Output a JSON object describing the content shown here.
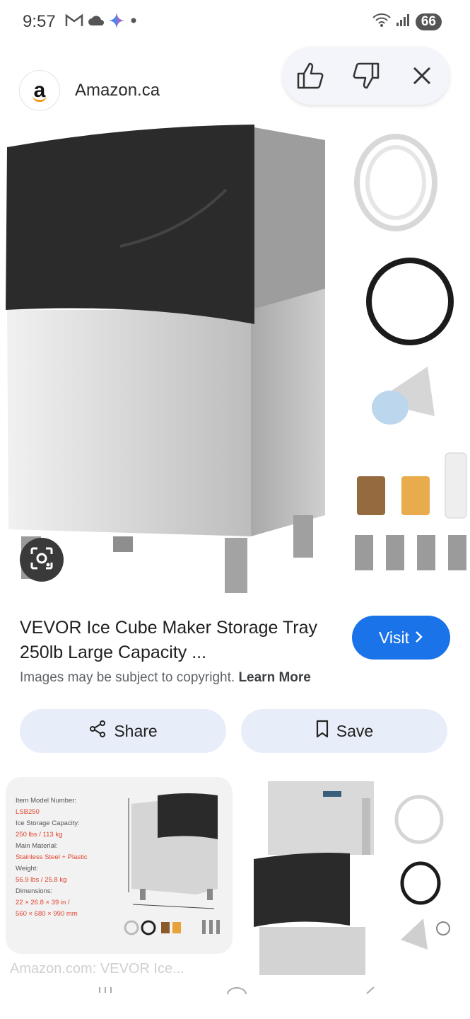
{
  "status": {
    "time": "9:57",
    "battery": "66",
    "left_icons": [
      "gmail-icon",
      "cloud-icon",
      "gemini-icon",
      "dot-icon"
    ],
    "right_icons": [
      "wifi-icon",
      "signal-icon"
    ]
  },
  "source": {
    "logo_letter": "a",
    "name": "Amazon.ca"
  },
  "result": {
    "title": "VEVOR Ice Cube Maker Storage Tray 250lb Large Capacity ...",
    "visit_label": "Visit",
    "copyright_text": "Images may be subject to copyright.",
    "learn_more": "Learn More"
  },
  "actions": {
    "share_label": "Share",
    "save_label": "Save"
  },
  "related": {
    "card1_specs": [
      {
        "k": "Item Model Number:",
        "v": "LSB250"
      },
      {
        "k": "Ice Storage Capacity:",
        "v": "250 lbs / 113 kg"
      },
      {
        "k": "Main Material:",
        "v": "Stainless Steel + Plastic"
      },
      {
        "k": "Weight:",
        "v": "56.9 lbs / 25.8 kg"
      },
      {
        "k": "Dimensions:",
        "v": "22 × 26.8 × 39  in /"
      },
      {
        "k": "",
        "v": "560 × 680 × 990 mm"
      }
    ],
    "caption": "Amazon.com: VEVOR Ice..."
  },
  "colors": {
    "accent": "#1a73e8",
    "pill_bg": "#e8eef9",
    "spec_red": "#e0452f"
  }
}
